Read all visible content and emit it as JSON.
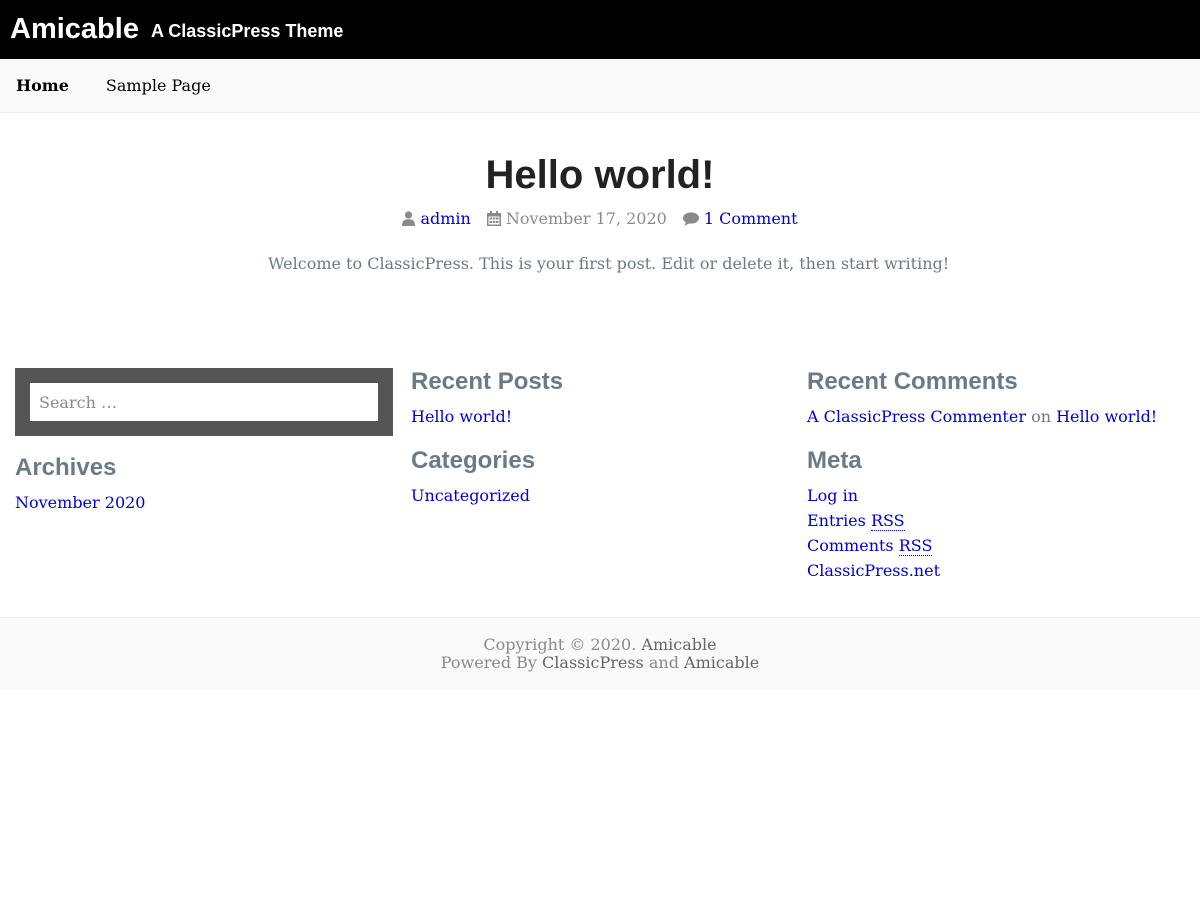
{
  "header": {
    "site_title": "Amicable",
    "site_description": "A ClassicPress Theme"
  },
  "nav": {
    "items": [
      {
        "label": "Home"
      },
      {
        "label": "Sample Page"
      }
    ]
  },
  "post": {
    "title": "Hello world!",
    "meta": {
      "author": "admin",
      "date": "November 17, 2020",
      "comments": "1 Comment"
    },
    "content": "Welcome to ClassicPress. This is your first post. Edit or delete it, then start writing!"
  },
  "search": {
    "placeholder": "Search …"
  },
  "widgets": {
    "archives": {
      "title": "Archives",
      "items": [
        "November 2020"
      ]
    },
    "recent_posts": {
      "title": "Recent Posts",
      "items": [
        "Hello world!"
      ]
    },
    "categories": {
      "title": "Categories",
      "items": [
        "Uncategorized"
      ]
    },
    "recent_comments": {
      "title": "Recent Comments",
      "author": "A ClassicPress Commenter",
      "on": "on",
      "post": "Hello world!"
    },
    "meta": {
      "title": "Meta",
      "login": "Log in",
      "entries": "Entries",
      "comments": "Comments",
      "rss": "RSS",
      "classicpress": "ClassicPress.net"
    }
  },
  "footer": {
    "copyright_prefix": "Copyright © 2020.",
    "copyright_site": "Amicable",
    "powered_by": "Powered By",
    "classicpress": "ClassicPress",
    "and": "and",
    "theme": "Amicable"
  },
  "icons": {
    "author": "user-icon",
    "date": "calendar-icon",
    "comments": "comment-icon"
  },
  "colors": {
    "link": "#0000cc",
    "header_bg": "#000000",
    "widget_title": "#6b7b86",
    "search_bg": "#555555"
  }
}
